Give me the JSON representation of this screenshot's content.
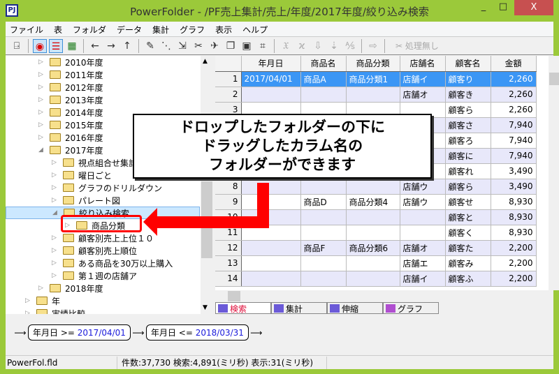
{
  "window": {
    "title": "PowerFolder - /PF売上集計/売上/年度/2017年度/絞り込み検索",
    "app_icon": "PJ",
    "minimize": "_",
    "maximize": "□",
    "close": "X"
  },
  "menu": [
    "ファイル",
    "表",
    "フォルダ",
    "データ",
    "集計",
    "グラフ",
    "表示",
    "ヘルプ"
  ],
  "toolbar": {
    "icons": [
      "exit-icon",
      "view-icon",
      "tree-icon",
      "table-icon",
      "back-icon",
      "forward-icon",
      "up-icon",
      "cut-icon",
      "filter-icon",
      "sort-icon",
      "split-icon",
      "merge-icon",
      "copy-icon",
      "calendar-icon",
      "html-icon",
      "x-icon",
      "xx-icon",
      "down-arrow-icon",
      "sort-down-icon",
      "ab-icon",
      "export-icon"
    ],
    "processing_label": "処理無し"
  },
  "tree": [
    {
      "label": "2010年度",
      "level": 2,
      "expanded": false
    },
    {
      "label": "2011年度",
      "level": 2,
      "expanded": false
    },
    {
      "label": "2012年度",
      "level": 2,
      "expanded": false
    },
    {
      "label": "2013年度",
      "level": 2,
      "expanded": false
    },
    {
      "label": "2014年度",
      "level": 2,
      "expanded": false
    },
    {
      "label": "2015年度",
      "level": 2,
      "expanded": false
    },
    {
      "label": "2016年度",
      "level": 2,
      "expanded": false
    },
    {
      "label": "2017年度",
      "level": 2,
      "expanded": true
    },
    {
      "label": "視点組合せ集計",
      "level": 3,
      "expanded": false
    },
    {
      "label": "曜日ごと",
      "level": 3,
      "expanded": false
    },
    {
      "label": "グラフのドリルダウン",
      "level": 3,
      "expanded": false
    },
    {
      "label": "パレート図",
      "level": 3,
      "expanded": false
    },
    {
      "label": "絞り込み検索",
      "level": 3,
      "expanded": true,
      "selected": true
    },
    {
      "label": "商品分類",
      "level": 4,
      "expanded": false,
      "highlighted": true
    },
    {
      "label": "顧客別売上上位１０",
      "level": 3,
      "expanded": false
    },
    {
      "label": "顧客別売上順位",
      "level": 3,
      "expanded": false
    },
    {
      "label": "ある商品を30万以上購入",
      "level": 3,
      "expanded": false
    },
    {
      "label": "第１週の店舗ア",
      "level": 3,
      "expanded": false
    },
    {
      "label": "2018年度",
      "level": 2,
      "expanded": false
    },
    {
      "label": "年",
      "level": 1,
      "expanded": false
    },
    {
      "label": "実績比較",
      "level": 1,
      "expanded": false
    }
  ],
  "grid": {
    "columns": [
      "年月日",
      "商品名",
      "商品分類",
      "店舗名",
      "顧客名",
      "金額"
    ],
    "rows": [
      [
        "1",
        "2017/04/01",
        "商品A",
        "商品分類1",
        "店舗イ",
        "顧客り",
        "2,260"
      ],
      [
        "2",
        "",
        "",
        "",
        "店舗オ",
        "顧客き",
        "2,260"
      ],
      [
        "3",
        "",
        "",
        "",
        "",
        "顧客ら",
        "2,260"
      ],
      [
        "4",
        "",
        "",
        "",
        "",
        "顧客さ",
        "7,940"
      ],
      [
        "5",
        "",
        "",
        "",
        "",
        "顧客ろ",
        "7,940"
      ],
      [
        "6",
        "",
        "",
        "",
        "",
        "顧客に",
        "7,940"
      ],
      [
        "7",
        "",
        "",
        "",
        "",
        "顧客れ",
        "3,490"
      ],
      [
        "8",
        "",
        "",
        "",
        "店舗ウ",
        "顧客ら",
        "3,490"
      ],
      [
        "9",
        "",
        "商品D",
        "商品分類4",
        "店舗ウ",
        "顧客せ",
        "8,930"
      ],
      [
        "10",
        "",
        "",
        "",
        "",
        "顧客と",
        "8,930"
      ],
      [
        "11",
        "",
        "",
        "",
        "",
        "顧客く",
        "8,930"
      ],
      [
        "12",
        "",
        "商品F",
        "商品分類6",
        "店舗オ",
        "顧客た",
        "2,200"
      ],
      [
        "13",
        "",
        "",
        "",
        "店舗エ",
        "顧客み",
        "2,200"
      ],
      [
        "14",
        "",
        "",
        "",
        "店舗イ",
        "顧客ふ",
        "2,200"
      ]
    ],
    "selected_row": 1
  },
  "tabs": [
    {
      "label": "検索",
      "active": true
    },
    {
      "label": "集計"
    },
    {
      "label": "伸縮"
    },
    {
      "label": "グラフ"
    }
  ],
  "filter": [
    {
      "field": "年月日",
      "op": ">=",
      "value": "2017/04/01"
    },
    {
      "field": "年月日",
      "op": "<=",
      "value": "2018/03/31"
    }
  ],
  "status": {
    "file": "PowerFol.fld",
    "info": "件数:37,730  検索:4,891(ミリ秒)  表示:31(ミリ秒)"
  },
  "callout": {
    "lines": [
      "ドロップしたフォルダーの下に",
      "ドラッグしたカラム名の",
      "フォルダーができます"
    ]
  },
  "colors": {
    "frame": "#9bc93a",
    "selection": "#3b96f5",
    "annotation": "#ff0000",
    "filter_value": "#1a1adb"
  }
}
